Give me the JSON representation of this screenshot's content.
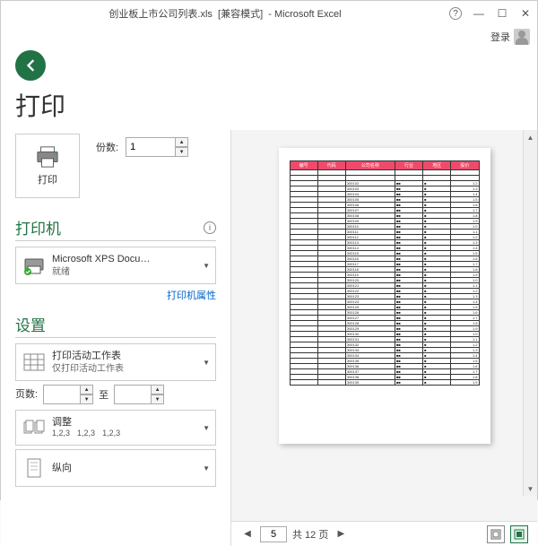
{
  "titlebar": {
    "filename": "创业板上市公司列表.xls",
    "mode": "[兼容模式]",
    "app": "- Microsoft Excel"
  },
  "account": {
    "signin": "登录"
  },
  "page": {
    "title": "打印"
  },
  "print_button": {
    "label": "打印"
  },
  "copies": {
    "label": "份数:",
    "value": "1"
  },
  "printer_section": {
    "title": "打印机"
  },
  "printer": {
    "name": "Microsoft XPS Docu…",
    "status": "就绪"
  },
  "printer_link": "打印机属性",
  "settings_section": {
    "title": "设置"
  },
  "setting_scope": {
    "main": "打印活动工作表",
    "sub": "仅打印活动工作表"
  },
  "pages": {
    "label": "页数:",
    "to": "至"
  },
  "collate": {
    "main": "调整",
    "seq": "1,2,3"
  },
  "orientation": {
    "main": "纵向"
  },
  "preview": {
    "current_page": "5",
    "total": "共 12 页",
    "headers": [
      "编号",
      "代码",
      "公司名称",
      "行业",
      "地区",
      "股价"
    ]
  }
}
